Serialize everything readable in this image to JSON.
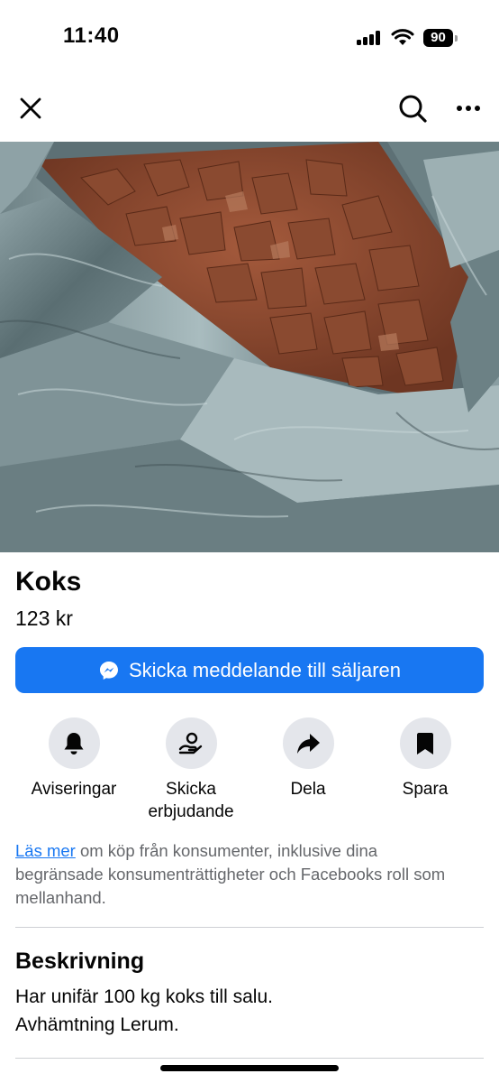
{
  "status_bar": {
    "time": "11:40",
    "battery_level": "90"
  },
  "listing": {
    "title": "Koks",
    "price": "123 kr",
    "message_button_label": "Skicka meddelande till säljaren"
  },
  "actions": [
    {
      "label": "Aviseringar",
      "icon": "bell-icon"
    },
    {
      "label": "Skicka erbjudande",
      "icon": "offer-hand-icon"
    },
    {
      "label": "Dela",
      "icon": "share-icon"
    },
    {
      "label": "Spara",
      "icon": "bookmark-icon"
    }
  ],
  "legal": {
    "link_text": "Läs mer",
    "text": " om köp från konsumenter, inklusive dina begränsade konsumenträttigheter och Facebooks roll som mellanhand."
  },
  "description": {
    "heading": "Beskrivning",
    "lines": [
      "Har unifär 100 kg koks till salu.",
      "Avhämtning Lerum."
    ]
  },
  "colors": {
    "accent": "#1877f2",
    "icon_circle": "#e4e6eb",
    "secondary_text": "#65676b"
  }
}
